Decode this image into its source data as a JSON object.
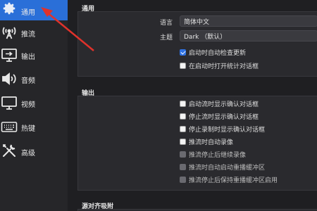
{
  "sidebar": {
    "items": [
      {
        "label": "通用",
        "icon": "gear-icon",
        "active": true
      },
      {
        "label": "推流",
        "icon": "broadcast-antenna-icon",
        "active": false
      },
      {
        "label": "输出",
        "icon": "output-monitor-icon",
        "active": false
      },
      {
        "label": "音频",
        "icon": "speaker-icon",
        "active": false
      },
      {
        "label": "视频",
        "icon": "display-monitor-icon",
        "active": false
      },
      {
        "label": "热键",
        "icon": "keyboard-icon",
        "active": false
      },
      {
        "label": "高级",
        "icon": "tools-icon",
        "active": false
      }
    ]
  },
  "general": {
    "title": "通用",
    "language_label": "语言",
    "language_value": "简体中文",
    "theme_label": "主题",
    "theme_value": "Dark （默认）",
    "check_updates": {
      "label": "启动时自动检查更新",
      "checked": true
    },
    "open_stats": {
      "label": "在启动时打开统计对话框",
      "checked": false
    }
  },
  "output": {
    "title": "输出",
    "options": [
      {
        "label": "启动流时显示确认对话框",
        "checked": false,
        "disabled": false
      },
      {
        "label": "停止流时显示确认对话框",
        "checked": false,
        "disabled": false
      },
      {
        "label": "停止录制时显示确认对话框",
        "checked": false,
        "disabled": false
      },
      {
        "label": "推流时自动录像",
        "checked": false,
        "disabled": false
      },
      {
        "label": "推流停止后继续录像",
        "checked": false,
        "disabled": true
      },
      {
        "label": "推流时自动启动重播缓冲区",
        "checked": false,
        "disabled": true
      },
      {
        "label": "推流停止后保持重播缓冲区启用",
        "checked": false,
        "disabled": true
      }
    ]
  },
  "snapping": {
    "title": "源对齐吸附"
  },
  "colors": {
    "accent": "#2a6fd8",
    "annotation_arrow": "#e0322b"
  }
}
